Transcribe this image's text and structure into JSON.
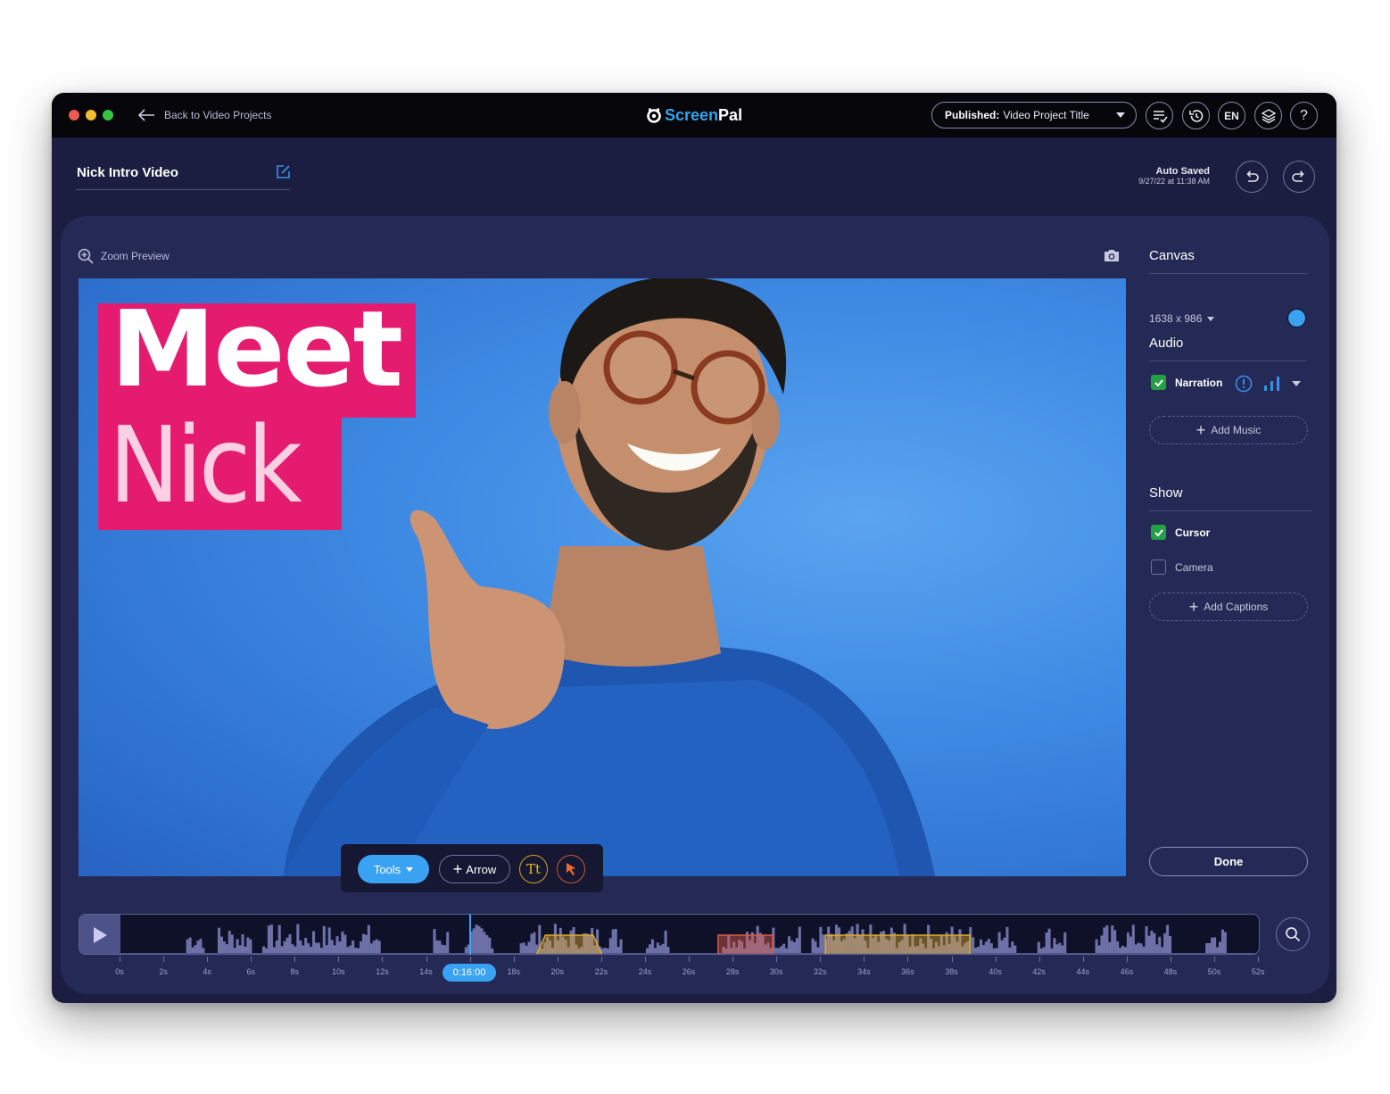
{
  "titlebar": {
    "back_label": "Back to Video Projects",
    "logo_part1": "Screen",
    "logo_part2": "Pal",
    "publish_status": "Published:",
    "publish_title": "Video Project Title",
    "icons": [
      "checklist-icon",
      "history-icon",
      "language",
      "layers-icon",
      "help-icon"
    ],
    "language_label": "EN",
    "help_label": "?"
  },
  "header": {
    "project_title": "Nick Intro Video",
    "autosave_label": "Auto Saved",
    "autosave_time": "9/27/22 at 11:38 AM"
  },
  "preview": {
    "zoom_label": "Zoom Preview",
    "overlay_line1": "Meet",
    "overlay_line2": "Nick",
    "overlay_color": "#e51b6f",
    "background_color": "#3f8be4"
  },
  "tools_bar": {
    "tools_label": "Tools",
    "arrow_label": "Arrow",
    "text_tool_label": "Tt"
  },
  "sidebar": {
    "canvas": {
      "heading": "Canvas",
      "size": "1638 x 986",
      "color": "#3aa2f2"
    },
    "audio": {
      "heading": "Audio",
      "narration_label": "Narration",
      "narration_checked": true,
      "add_music_label": "Add Music"
    },
    "show": {
      "heading": "Show",
      "cursor_label": "Cursor",
      "cursor_checked": true,
      "camera_label": "Camera",
      "camera_checked": false,
      "add_captions_label": "Add Captions"
    },
    "done_label": "Done"
  },
  "timeline": {
    "playhead_time": "0:16:00",
    "playhead_seconds": 16,
    "duration_seconds": 52,
    "tick_labels": [
      "0s",
      "2s",
      "4s",
      "6s",
      "8s",
      "10s",
      "12s",
      "14s",
      "16s",
      "18s",
      "20s",
      "22s",
      "24s",
      "26s",
      "28s",
      "30s",
      "32s",
      "34s",
      "36s",
      "38s",
      "40s",
      "42s",
      "44s",
      "46s",
      "48s",
      "50s",
      "52s"
    ],
    "segments": [
      {
        "type": "speed",
        "start": 19.0,
        "end": 22.0,
        "color": "#e0a92a"
      },
      {
        "type": "cut",
        "start": 27.3,
        "end": 29.8,
        "color": "#e05a45"
      },
      {
        "type": "speed",
        "start": 32.2,
        "end": 38.8,
        "color": "#e0a92a"
      }
    ]
  }
}
